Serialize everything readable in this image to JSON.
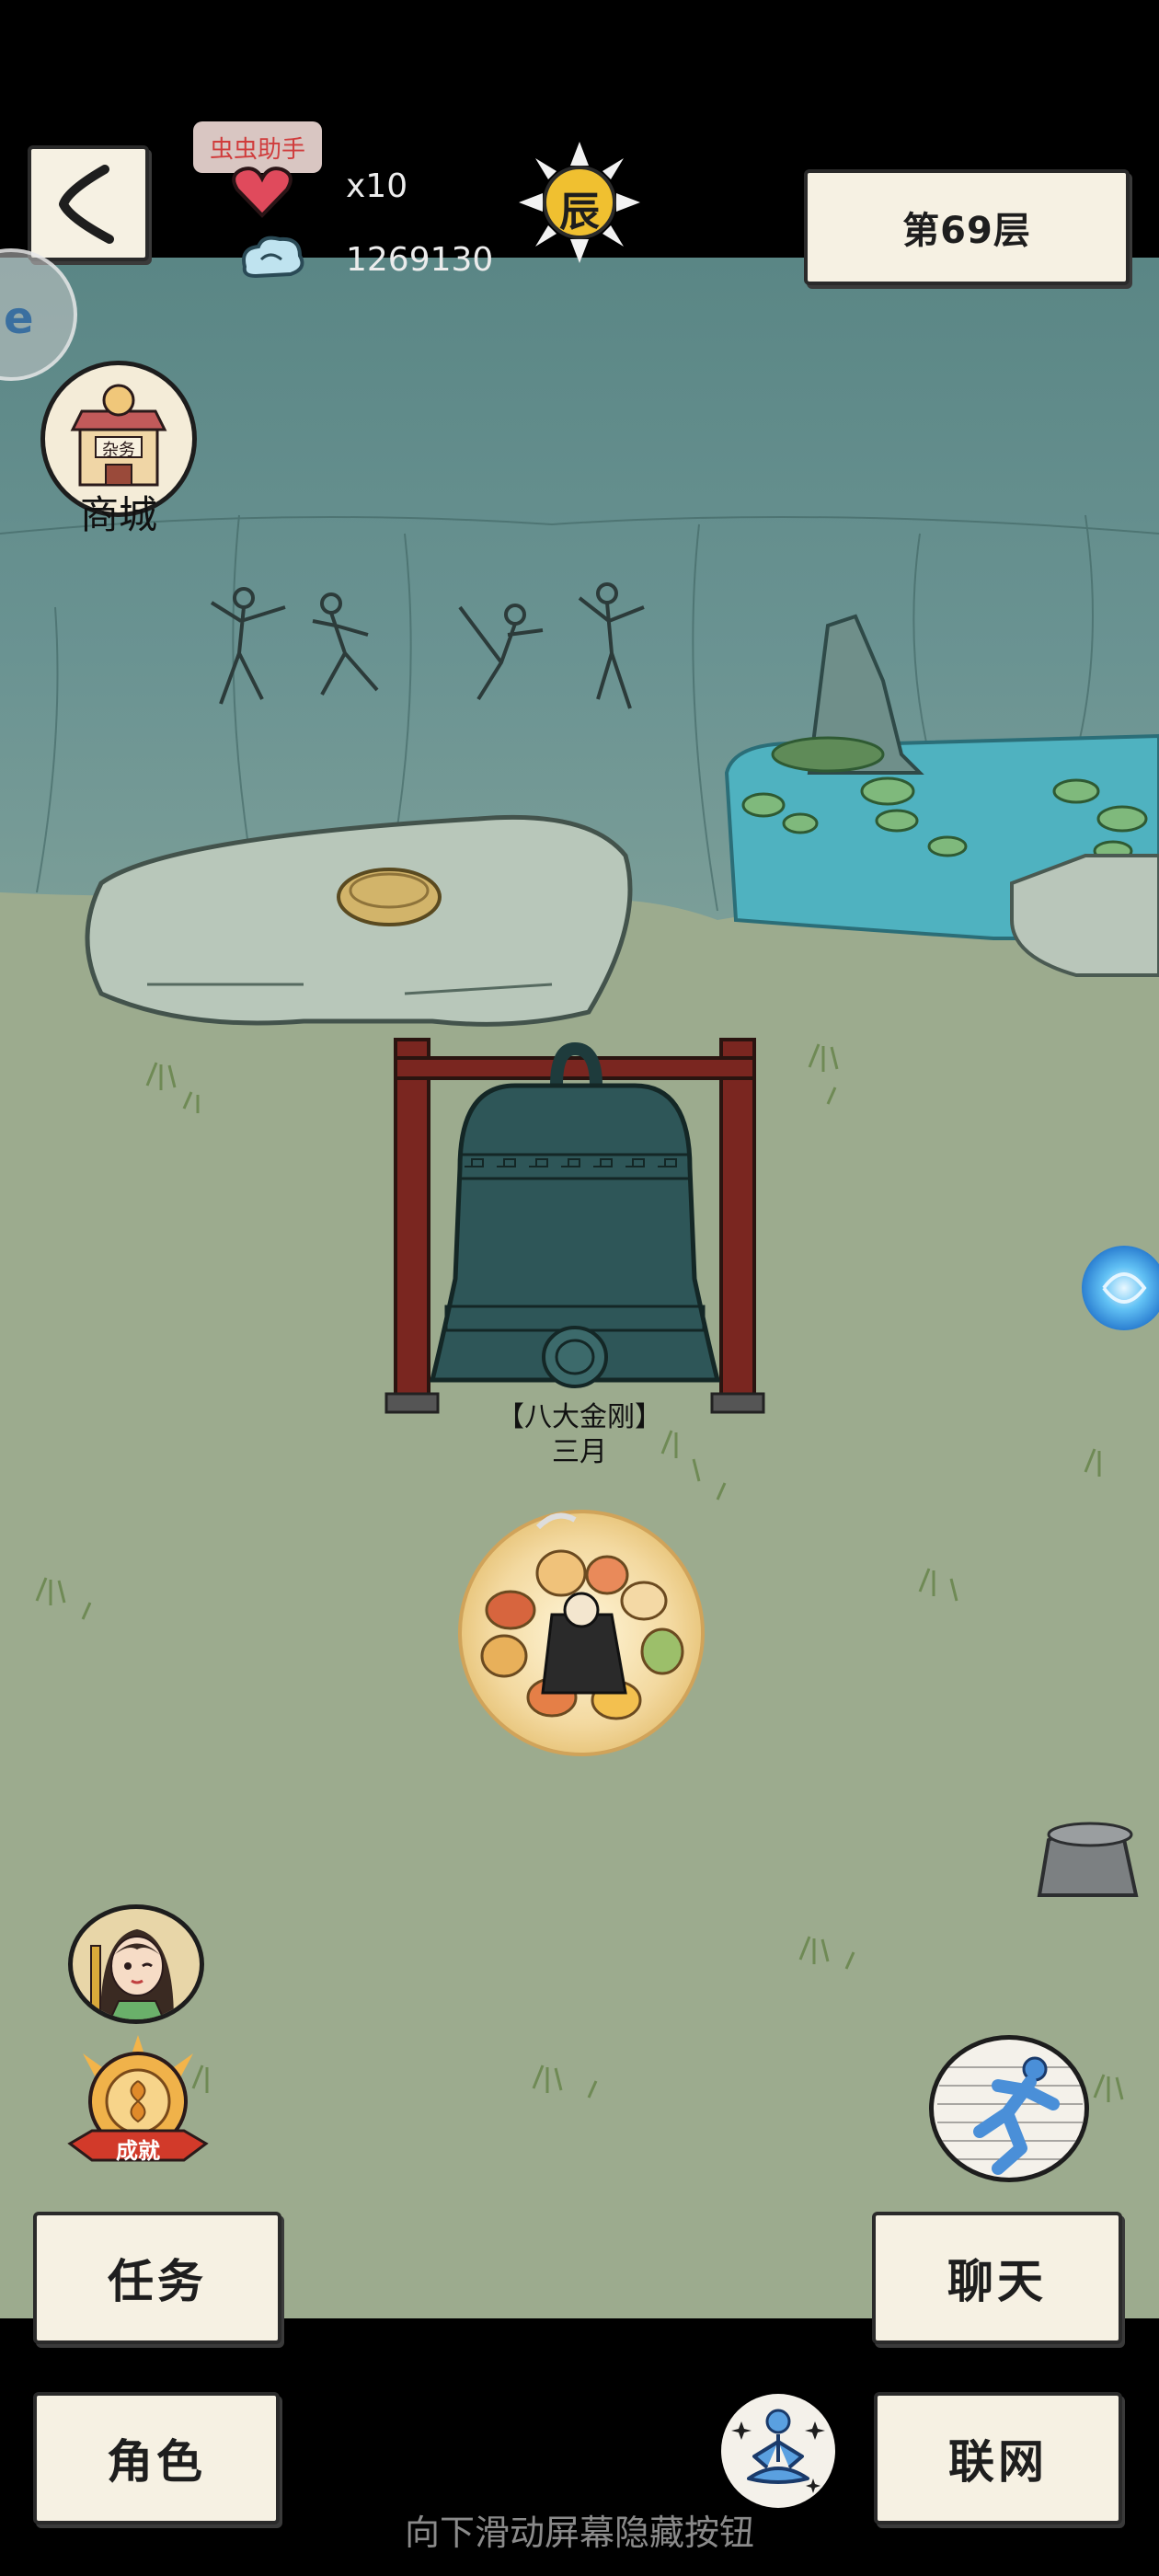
{
  "hud": {
    "helper_badge": "虫虫助手",
    "lives_count": "x10",
    "currency_value": "1269130",
    "time_glyph": "辰",
    "floor_label": "第69层"
  },
  "shop": {
    "label": "商城",
    "sign_text": "杂务"
  },
  "npc": {
    "title": "【八大金刚】",
    "name": "三月"
  },
  "achievement": {
    "ribbon_text": "成就"
  },
  "buttons": {
    "tasks": "任务",
    "character": "角色",
    "chat": "聊天",
    "network": "联网"
  },
  "hint": "向下滑动屏幕隐藏按钮",
  "colors": {
    "ground": "#9cab8e",
    "cliff": "#5f8a8a",
    "pond": "#4fb2c0",
    "paper": "#f6f1e3",
    "bell": "#2e5658",
    "frame": "#7a2620"
  }
}
